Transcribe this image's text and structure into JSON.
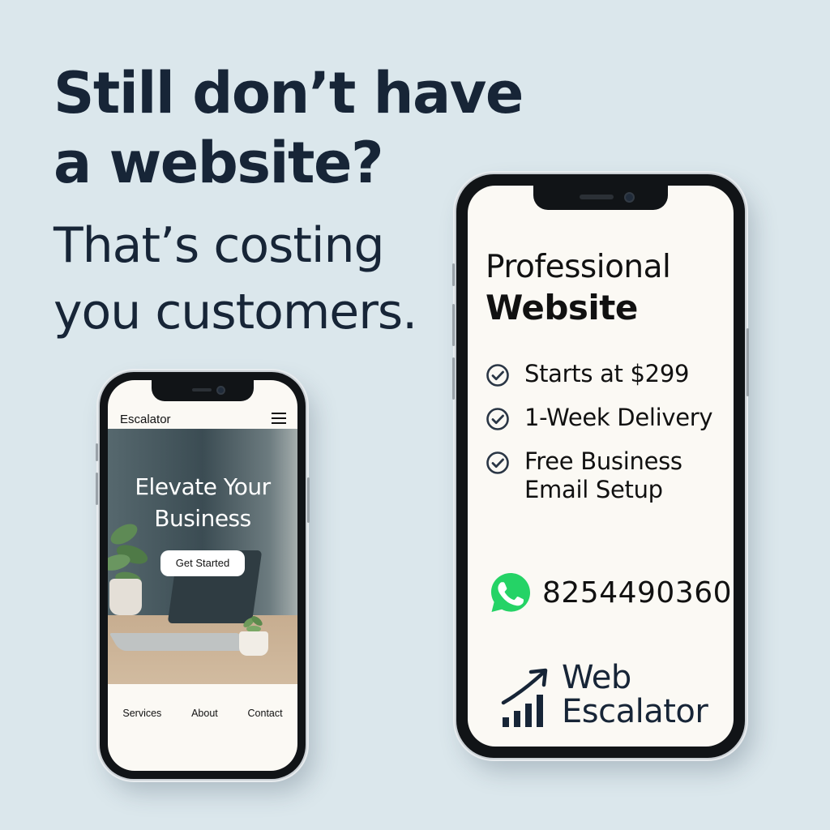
{
  "headline": {
    "line1": "Still don’t have",
    "line2": "a website?"
  },
  "subhead": {
    "line1": "That’s costing",
    "line2": "you customers."
  },
  "mockup_site": {
    "brand": "Escalator",
    "menu_icon": "hamburger-menu-icon",
    "hero_title_line1": "Elevate Your",
    "hero_title_line2": "Business",
    "cta_label": "Get Started",
    "nav": [
      "Services",
      "About",
      "Contact"
    ]
  },
  "promo": {
    "title_line1": "Professional",
    "title_line2": "Website",
    "features": [
      {
        "lines": [
          "Starts at $299"
        ],
        "icon": "check-circle-icon"
      },
      {
        "lines": [
          "1-Week Delivery"
        ],
        "icon": "check-circle-icon"
      },
      {
        "lines": [
          "Free Business",
          "Email Setup"
        ],
        "icon": "check-circle-icon"
      }
    ],
    "contact": {
      "icon": "whatsapp-icon",
      "phone": "8254490360"
    },
    "logo": {
      "line1": "Web",
      "line2": "Escalator",
      "icon": "growth-chart-arrow-icon"
    }
  },
  "colors": {
    "background": "#dbe7ec",
    "text_dark": "#172537",
    "screen": "#fbf9f4",
    "whatsapp_green": "#25d366"
  }
}
